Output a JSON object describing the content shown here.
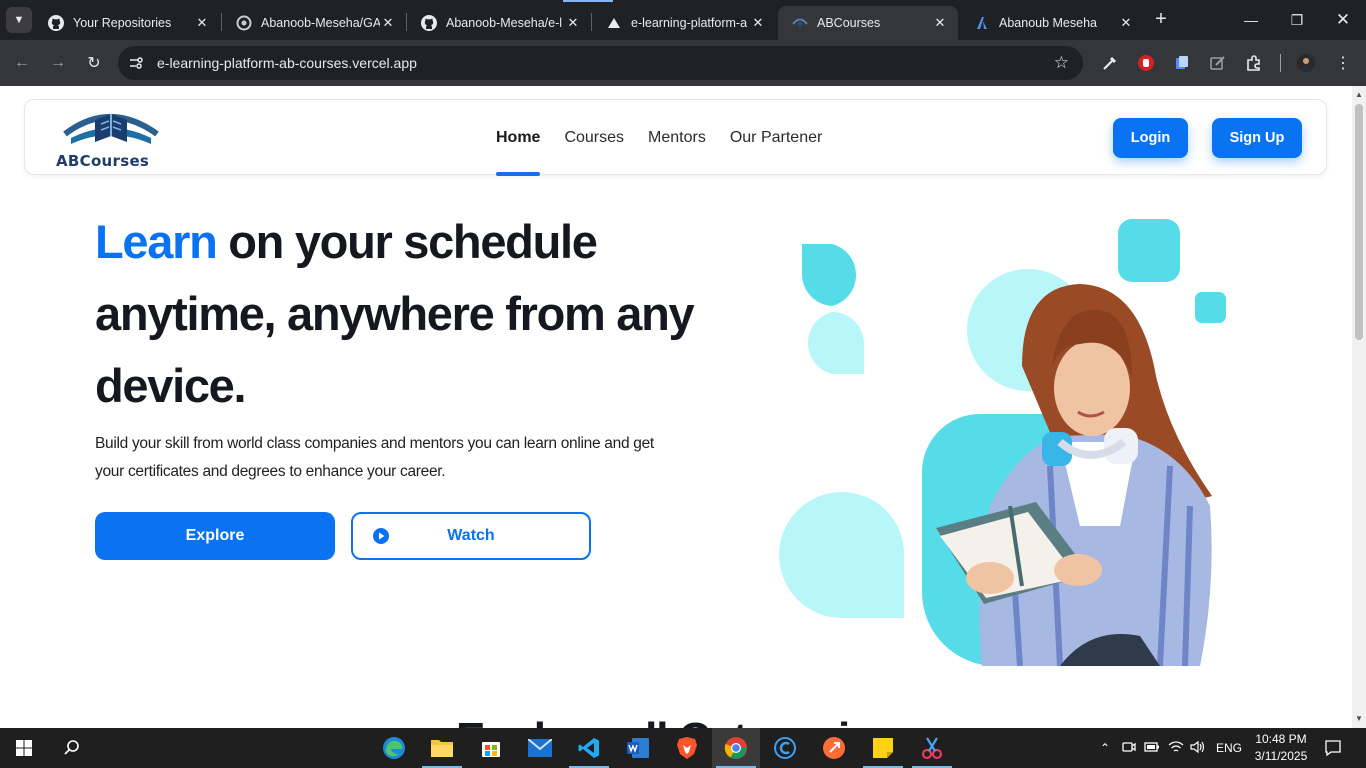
{
  "browser": {
    "tabs": [
      {
        "title": "Your Repositories",
        "icon": "github-icon",
        "active": false
      },
      {
        "title": "Abanoob-Meseha/GA",
        "icon": "globe-icon",
        "active": false
      },
      {
        "title": "Abanoob-Meseha/e-l",
        "icon": "github-icon",
        "active": false
      },
      {
        "title": "e-learning-platform-a",
        "icon": "vercel-icon",
        "active": false
      },
      {
        "title": "ABCourses",
        "icon": "abcourses-icon",
        "active": true
      },
      {
        "title": "Abanoub Meseha",
        "icon": "a-logo-icon",
        "active": false
      }
    ],
    "url": "e-learning-platform-ab-courses.vercel.app"
  },
  "site": {
    "brand": "ABCourses",
    "nav": {
      "home": "Home",
      "courses": "Courses",
      "mentors": "Mentors",
      "partners": "Our Partener"
    },
    "login_label": "Login",
    "signup_label": "Sign Up",
    "hero": {
      "title_accent": "Learn",
      "title_rest": " on your schedule anytime, anywhere from any device.",
      "description": "Build your skill from world class companies and mentors you can learn online and get your certificates and degrees to enhance your career.",
      "explore_label": "Explore",
      "watch_label": "Watch"
    },
    "next_section_title": "Explore all Categories"
  },
  "taskbar": {
    "apps": [
      "edge-icon",
      "file-explorer-icon",
      "store-icon",
      "mail-icon",
      "vscode-icon",
      "word-icon",
      "brave-icon",
      "chrome-icon",
      "c-app-icon",
      "postman-icon",
      "sticky-notes-icon",
      "snipping-tool-icon"
    ],
    "language": "ENG",
    "time": "10:48 PM",
    "date": "3/11/2025"
  },
  "colors": {
    "accent": "#0a73f2",
    "dark_text": "#15191f",
    "art_cyan": "#56dce8",
    "art_light_cyan": "#b9f6fa"
  }
}
